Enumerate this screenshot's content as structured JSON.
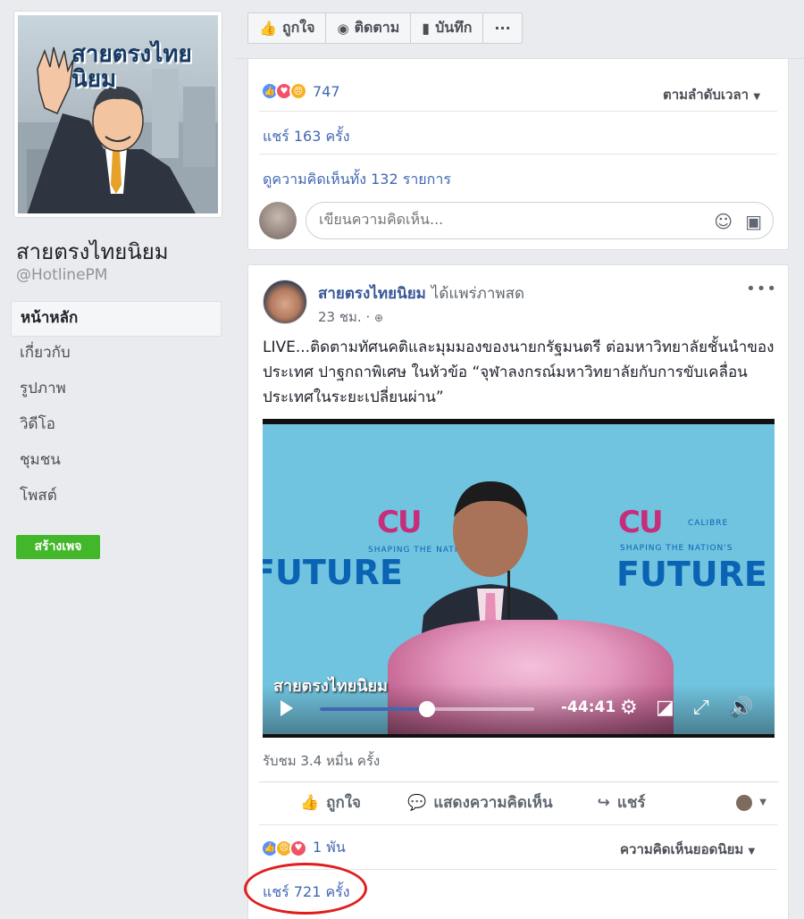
{
  "sidebar": {
    "page_name": "สายตรงไทยนิยม",
    "handle": "@HotlinePM",
    "logo_text": "สายตรงไทยนิยม",
    "nav": [
      {
        "label": "หน้าหลัก",
        "active": true
      },
      {
        "label": "เกี่ยวกับ",
        "active": false
      },
      {
        "label": "รูปภาพ",
        "active": false
      },
      {
        "label": "วิดีโอ",
        "active": false
      },
      {
        "label": "ชุมชน",
        "active": false
      },
      {
        "label": "โพสต์",
        "active": false
      }
    ],
    "create_page": "สร้างเพจ"
  },
  "action_bar": {
    "like": "ถูกใจ",
    "follow": "ติดตาม",
    "save": "บันทึก",
    "more": "···"
  },
  "post1": {
    "reaction_count": "747",
    "sort_label": "ตามลำดับเวลา",
    "shares": "แชร์ 163 ครั้ง",
    "view_comments": "ดูความคิดเห็นทั้ง 132 รายการ",
    "comment_placeholder": "เขียนความคิดเห็น..."
  },
  "post2": {
    "author": "สายตรงไทยนิยม",
    "author_action": "ได้แพร่ภาพสด",
    "time": "23 ชม. ·",
    "text": "LIVE...ติดตามทัศนคติและมุมมองของนายกรัฐมนตรี ต่อมหาวิทยาลัยชั้นนำของประเทศ ปาฐกถาพิเศษ ในหัวข้อ “จุฬาลงกรณ์มหาวิทยาลัยกับการขับเคลื่อนประเทศในระยะเปลี่ยนผ่าน”",
    "video": {
      "time_remaining": "-44:41",
      "progress": 0.5,
      "watermark": "สายตรงไทยนิยม",
      "banner_left": "FUTURE",
      "banner_right": "FUTURE",
      "banner_small": "SHAPING THE NATION'S",
      "calibre": "CALIBRE"
    },
    "views": "รับชม 3.4 หมื่น ครั้ง",
    "actions": {
      "like": "ถูกใจ",
      "comment": "แสดงความคิดเห็น",
      "share": "แชร์"
    },
    "reaction_count": "1 พัน",
    "sort_label": "ความคิดเห็นยอดนิยม",
    "shares": "แชร์ 721 ครั้ง"
  },
  "colors": {
    "link": "#4267b2",
    "highlight_oval": "#e11d1d",
    "create_page_bg": "#42b72a"
  }
}
